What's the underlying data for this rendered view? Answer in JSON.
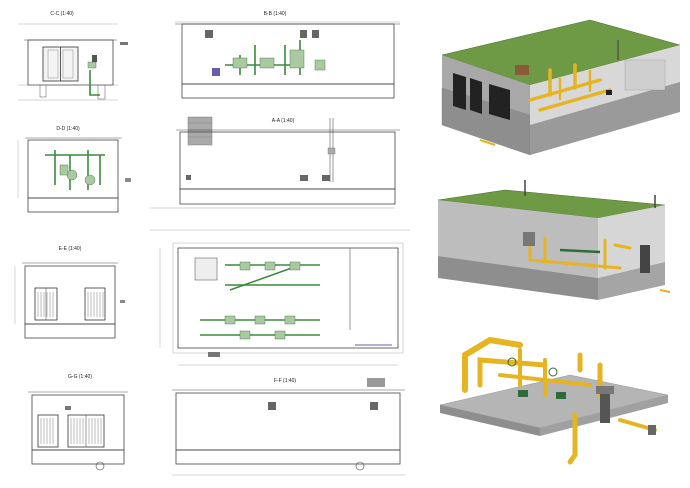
{
  "sections": {
    "cc": "C-C (1:40)",
    "bb": "B-B (1:40)",
    "dd": "D-D (1:40)",
    "aa": "A-A (1:40)",
    "ee": "E-E (1:40)",
    "gg": "G-G (1:40)",
    "ff": "F-F (1:40)"
  },
  "colors": {
    "pipe_yellow": "#e6b422",
    "roof_green": "#6f9a45",
    "wall_grey": "#bdbdbd",
    "base_grey": "#8e8e8e",
    "pipe_green_2d": "#3b8a3b"
  },
  "views_3d": [
    "cutaway-building-view",
    "side-building-view",
    "pipework-only-view"
  ]
}
